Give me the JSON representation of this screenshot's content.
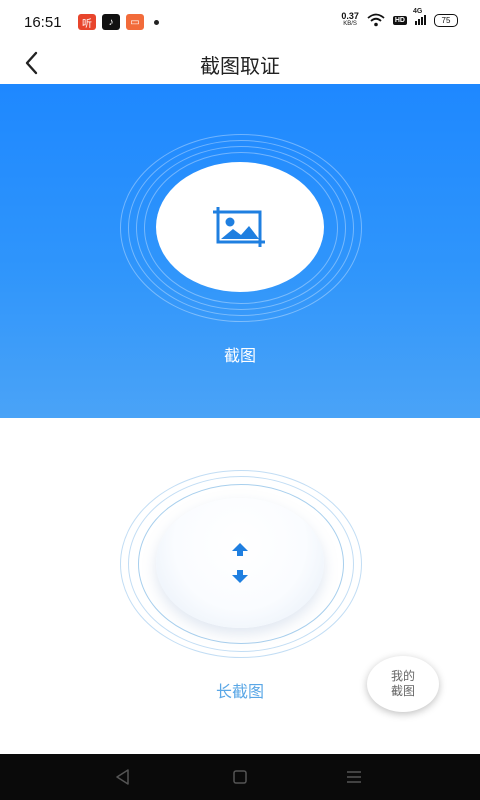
{
  "status_bar": {
    "time": "16:51",
    "app_icons": [
      {
        "name": "listen-app-icon",
        "glyph": "听",
        "color": "#e8452c"
      },
      {
        "name": "tiktok-app-icon",
        "glyph": "♪",
        "color": "#111111"
      },
      {
        "name": "video-app-icon",
        "glyph": "▭",
        "color": "#f26b3a"
      }
    ],
    "net_speed_value": "0.37",
    "net_speed_unit": "KB/S",
    "hd_badge": "HD",
    "network_type": "4G",
    "battery": "75"
  },
  "header": {
    "title": "截图取证"
  },
  "screenshot": {
    "label": "截图"
  },
  "long_screenshot": {
    "label": "长截图"
  },
  "fab": {
    "line1": "我的",
    "line2": "截图"
  },
  "colors": {
    "primary": "#1e88ff",
    "icon_blue": "#1f7fe0",
    "label_light_blue": "#5aa7e6"
  }
}
